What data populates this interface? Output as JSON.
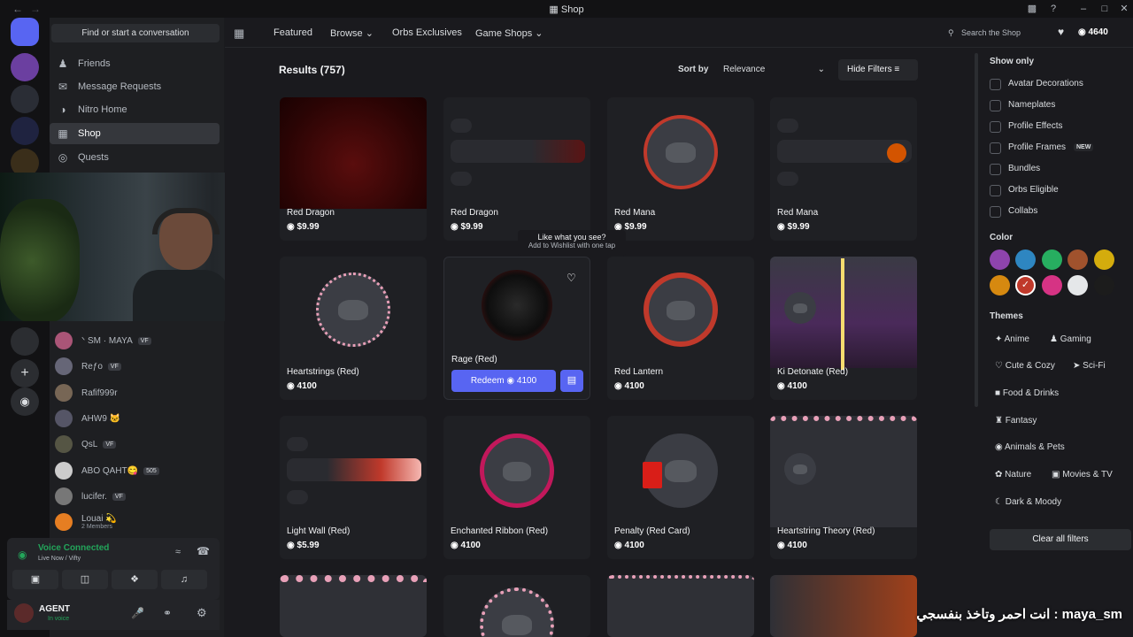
{
  "window": {
    "title": "Shop"
  },
  "sidebar": {
    "find_placeholder": "Find or start a conversation",
    "nav": [
      {
        "label": "Friends"
      },
      {
        "label": "Message Requests"
      },
      {
        "label": "Nitro Home"
      },
      {
        "label": "Shop"
      },
      {
        "label": "Quests"
      }
    ],
    "dms": [
      {
        "name": "ᐠ SM · MAYA",
        "badge": "VF"
      },
      {
        "name": "Reƒo",
        "badge": "VF"
      },
      {
        "name": "Rafif999r",
        "badge": ""
      },
      {
        "name": "AHW9 🐱",
        "badge": ""
      },
      {
        "name": "QsL",
        "badge": "VF"
      },
      {
        "name": "ABO QAHT😋",
        "badge": "505"
      },
      {
        "name": "lucifer.",
        "badge": "VF"
      },
      {
        "name": "Louai 💫",
        "badge": "",
        "sub": "2 Members"
      }
    ],
    "voice": {
      "status": "Voice Connected",
      "channel": "Live Now / Vifty"
    },
    "user": {
      "name": "AGENT",
      "status": "In voice"
    }
  },
  "topnav": {
    "tabs": [
      "Featured",
      "Browse",
      "Orbs Exclusives",
      "Game Shops"
    ],
    "search_placeholder": "Search the Shop",
    "orbs": "4640"
  },
  "results": {
    "title": "Results (757)",
    "sort_label": "Sort by",
    "sort_value": "Relevance",
    "hide_filters": "Hide Filters",
    "tooltip": {
      "title": "Like what you see?",
      "sub": "Add to Wishlist with one tap"
    },
    "redeem_label": "Redeem",
    "redeem_price": "4100",
    "items": [
      {
        "name": "Red Dragon",
        "price": "$9.99"
      },
      {
        "name": "Red Dragon",
        "price": "$9.99"
      },
      {
        "name": "Red Mana",
        "price": "$9.99"
      },
      {
        "name": "Red Mana",
        "price": "$9.99"
      },
      {
        "name": "Heartstrings (Red)",
        "price": "4100"
      },
      {
        "name": "Rage (Red)",
        "price": "4100"
      },
      {
        "name": "Red Lantern",
        "price": "4100"
      },
      {
        "name": "Ki Detonate (Red)",
        "price": "4100"
      },
      {
        "name": "Light Wall (Red)",
        "price": "$5.99"
      },
      {
        "name": "Enchanted Ribbon (Red)",
        "price": "4100"
      },
      {
        "name": "Penalty (Red Card)",
        "price": "4100"
      },
      {
        "name": "Heartstring Theory (Red)",
        "price": "4100"
      }
    ]
  },
  "filters": {
    "show_only_title": "Show only",
    "show_only": [
      "Avatar Decorations",
      "Nameplates",
      "Profile Effects",
      "Profile Frames",
      "Bundles",
      "Orbs Eligible",
      "Collabs"
    ],
    "new_badge": "NEW",
    "color_title": "Color",
    "colors": [
      "#8e44ad",
      "#2e86c1",
      "#27ae60",
      "#a0522d",
      "#d4ac0d",
      "#d68910",
      "#c0392b",
      "#d63384",
      "#e5e7e9",
      "#1c1c1c"
    ],
    "themes_title": "Themes",
    "themes": [
      "Anime",
      "Gaming",
      "Cute & Cozy",
      "Sci-Fi",
      "Food & Drinks",
      "Fantasy",
      "Animals & Pets",
      "Nature",
      "Movies & TV",
      "Dark & Moody"
    ],
    "clear_all": "Clear all filters"
  },
  "overlay_text": "انت احمر وتاخذ بنفسجي : maya_sm"
}
